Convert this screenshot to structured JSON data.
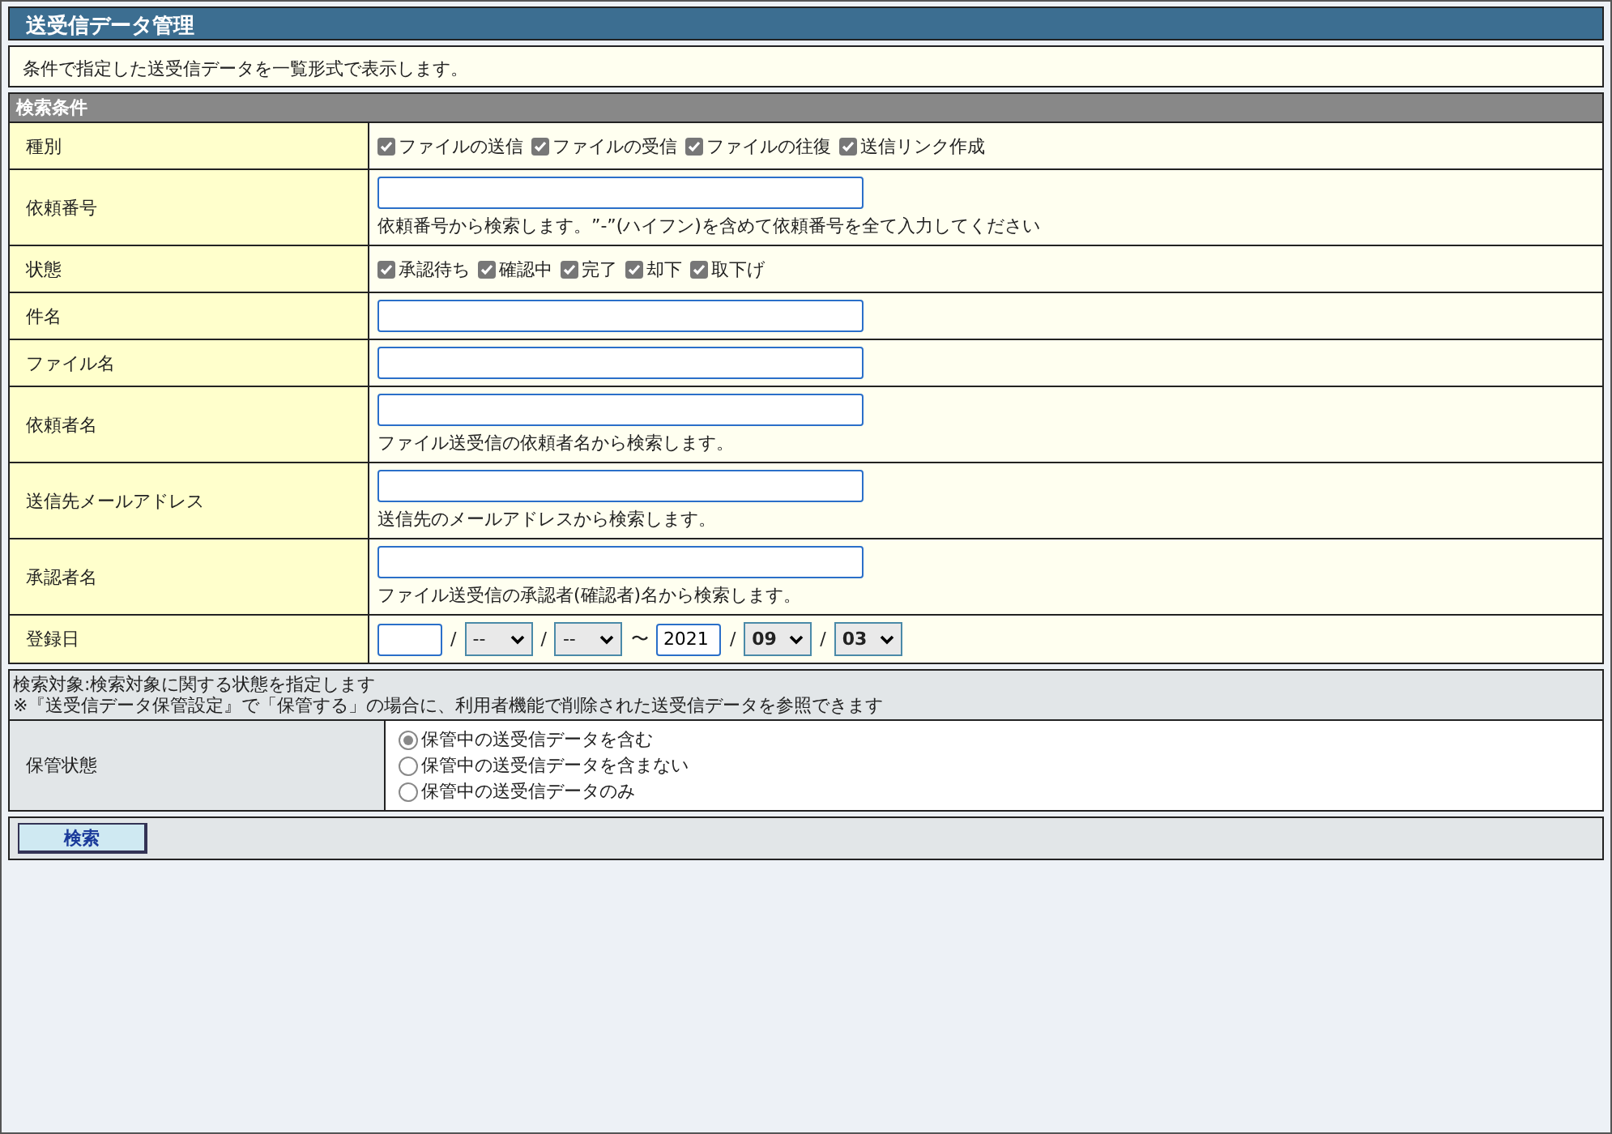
{
  "title": "送受信データ管理",
  "description": "条件で指定した送受信データを一覧形式で表示します。",
  "section_title": "検索条件",
  "rows": [
    {
      "kind": "checks",
      "label": "種別",
      "options": [
        {
          "label": "ファイルの送信",
          "checked": true
        },
        {
          "label": "ファイルの受信",
          "checked": true
        },
        {
          "label": "ファイルの往復",
          "checked": true
        },
        {
          "label": "送信リンク作成",
          "checked": true
        }
      ]
    },
    {
      "kind": "text",
      "label": "依頼番号",
      "hint": "依頼番号から検索します。”-”(ハイフン)を含めて依頼番号を全て入力してください"
    },
    {
      "kind": "checks",
      "label": "状態",
      "options": [
        {
          "label": "承認待ち",
          "checked": true
        },
        {
          "label": "確認中",
          "checked": true
        },
        {
          "label": "完了",
          "checked": true
        },
        {
          "label": "却下",
          "checked": true
        },
        {
          "label": "取下げ",
          "checked": true
        }
      ]
    },
    {
      "kind": "text",
      "label": "件名"
    },
    {
      "kind": "text",
      "label": "ファイル名"
    },
    {
      "kind": "text",
      "label": "依頼者名",
      "hint": "ファイル送受信の依頼者名から検索します。"
    },
    {
      "kind": "text",
      "label": "送信先メールアドレス",
      "hint": "送信先のメールアドレスから検索します。"
    },
    {
      "kind": "text",
      "label": "承認者名",
      "hint": "ファイル送受信の承認者(確認者)名から検索します。"
    },
    {
      "kind": "date",
      "label": "登録日",
      "parts": [
        {
          "kind": "input"
        },
        {
          "kind": "sep",
          "text": "/"
        },
        {
          "kind": "select",
          "value": "--"
        },
        {
          "kind": "sep",
          "text": "/"
        },
        {
          "kind": "select",
          "value": "--"
        },
        {
          "kind": "sep",
          "text": "〜"
        },
        {
          "kind": "input",
          "value": "2021"
        },
        {
          "kind": "sep",
          "text": "/"
        },
        {
          "kind": "select",
          "value": "09",
          "bold": true
        },
        {
          "kind": "sep",
          "text": "/"
        },
        {
          "kind": "select",
          "value": "03",
          "bold": true
        }
      ]
    }
  ],
  "archive": {
    "notes": [
      "検索対象:検索対象に関する状態を指定します",
      "※『送受信データ保管設定』で「保管する」の場合に、利用者機能で削除された送受信データを参照できます"
    ],
    "label": "保管状態",
    "options": [
      {
        "label": "保管中の送受信データを含む",
        "selected": true
      },
      {
        "label": "保管中の送受信データを含まない",
        "selected": false
      },
      {
        "label": "保管中の送受信データのみ",
        "selected": false
      }
    ]
  },
  "search_button": "検索"
}
